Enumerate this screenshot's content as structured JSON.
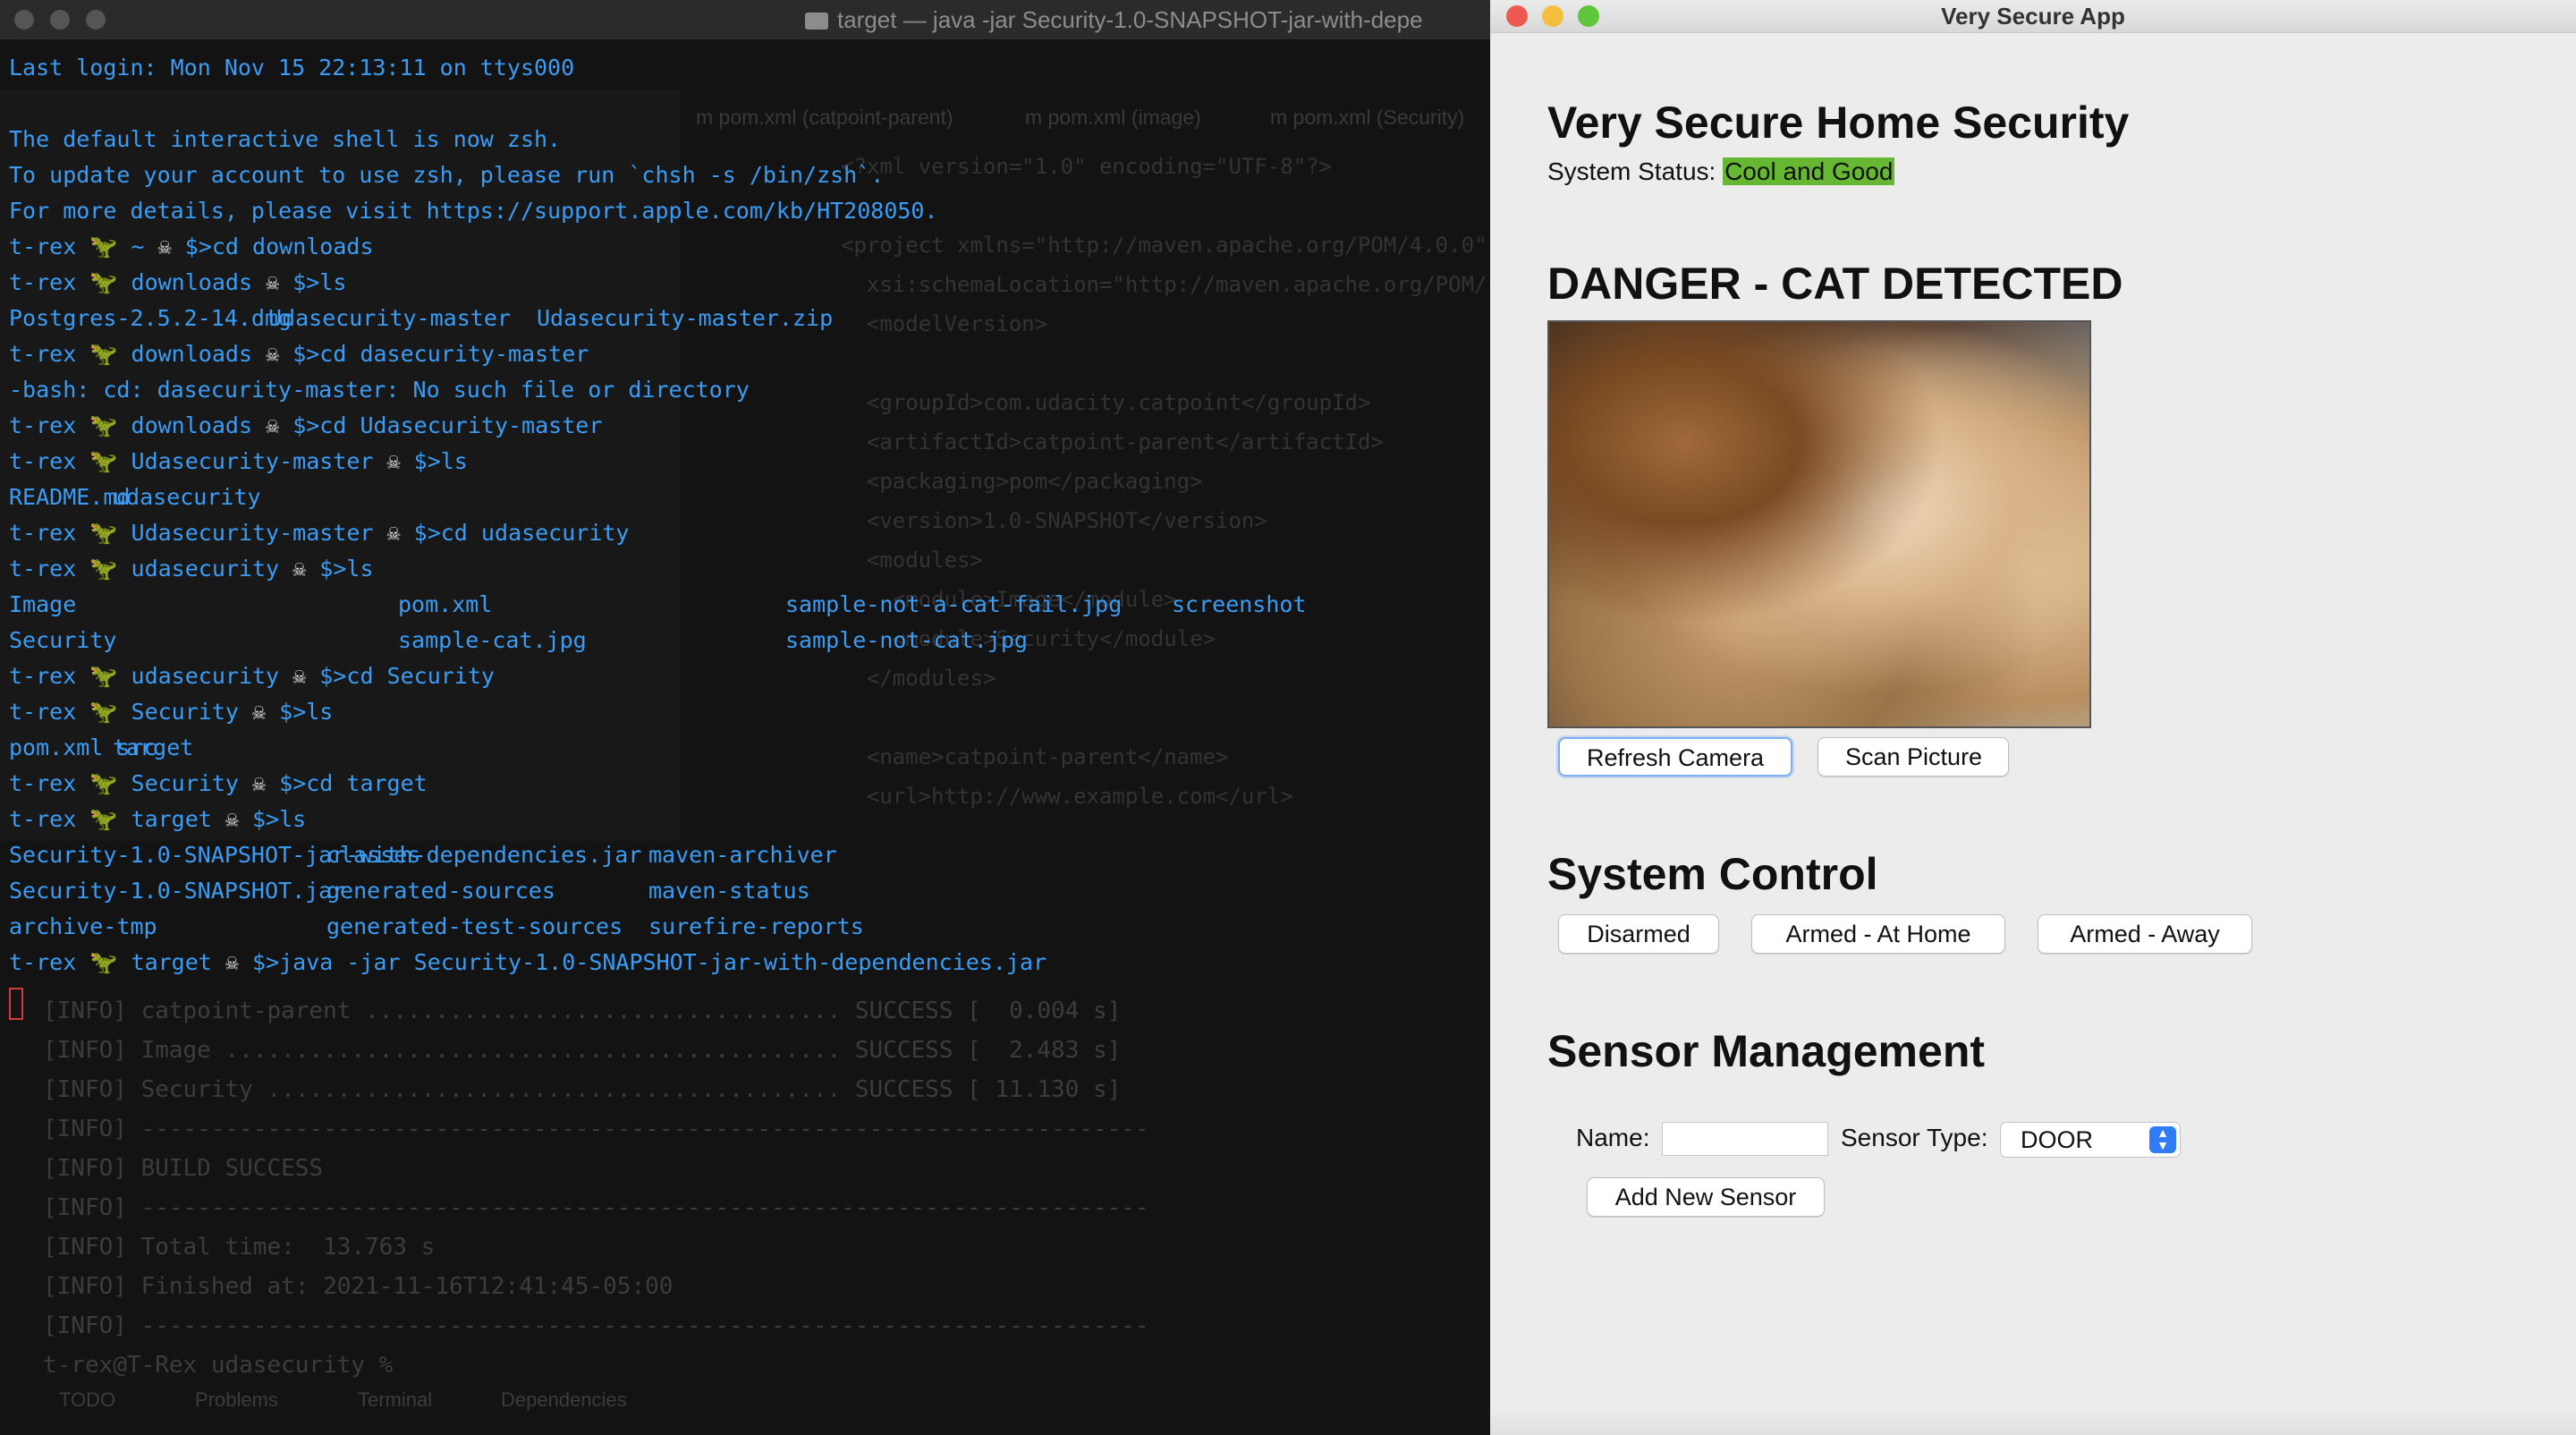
{
  "terminal": {
    "title": "target — java -jar Security-1.0-SNAPSHOT-jar-with-depe",
    "lines": [
      {
        "text": "Last login: Mon Nov 15 22:13:11 on ttys000"
      },
      {
        "text": ""
      },
      {
        "text": "The default interactive shell is now zsh."
      },
      {
        "text": "To update your account to use zsh, please run `chsh -s /bin/zsh`."
      },
      {
        "text": "For more details, please visit https://support.apple.com/kb/HT208050."
      },
      {
        "prompt": "t-rex",
        "dir": "~",
        "cmd": "$>cd downloads"
      },
      {
        "prompt": "t-rex",
        "dir": "downloads",
        "cmd": "$>ls"
      },
      {
        "cols": [
          "Postgres-2.5.2-14.dmg",
          "Udasecurity-master",
          "Udasecurity-master.zip"
        ]
      },
      {
        "prompt": "t-rex",
        "dir": "downloads",
        "cmd": "$>cd dasecurity-master"
      },
      {
        "text": "-bash: cd: dasecurity-master: No such file or directory"
      },
      {
        "prompt": "t-rex",
        "dir": "downloads",
        "cmd": "$>cd Udasecurity-master"
      },
      {
        "prompt": "t-rex",
        "dir": "Udasecurity-master",
        "cmd": "$>ls"
      },
      {
        "cols": [
          "README.md",
          "udasecurity"
        ]
      },
      {
        "prompt": "t-rex",
        "dir": "Udasecurity-master",
        "cmd": "$>cd udasecurity"
      },
      {
        "prompt": "t-rex",
        "dir": "udasecurity",
        "cmd": "$>ls"
      },
      {
        "cols": [
          "Image",
          "pom.xml",
          "sample-not-a-cat-fail.jpg",
          "screenshot"
        ]
      },
      {
        "cols": [
          "Security",
          "sample-cat.jpg",
          "sample-not-cat.jpg"
        ]
      },
      {
        "prompt": "t-rex",
        "dir": "udasecurity",
        "cmd": "$>cd Security"
      },
      {
        "prompt": "t-rex",
        "dir": "Security",
        "cmd": "$>ls"
      },
      {
        "cols": [
          "pom.xml src",
          "target"
        ]
      },
      {
        "prompt": "t-rex",
        "dir": "Security",
        "cmd": "$>cd target"
      },
      {
        "prompt": "t-rex",
        "dir": "target",
        "cmd": "$>ls"
      },
      {
        "cols": [
          "Security-1.0-SNAPSHOT-jar-with-dependencies.jar",
          "classes",
          "maven-archiver"
        ]
      },
      {
        "cols": [
          "Security-1.0-SNAPSHOT.jar",
          "generated-sources",
          "maven-status"
        ]
      },
      {
        "cols": [
          "archive-tmp",
          "generated-test-sources",
          "surefire-reports"
        ]
      },
      {
        "prompt": "t-rex",
        "dir": "target",
        "cmd": "$>java -jar Security-1.0-SNAPSHOT-jar-with-dependencies.jar"
      },
      {
        "cursor": true
      }
    ]
  },
  "app": {
    "window_title": "Very Secure App",
    "title": "Very Secure Home Security",
    "status_label": "System Status:",
    "status_value": "Cool and Good",
    "danger_heading": "DANGER - CAT DETECTED",
    "camera_buttons": {
      "refresh": "Refresh Camera",
      "scan": "Scan Picture"
    },
    "control_heading": "System Control",
    "control_buttons": {
      "disarmed": "Disarmed",
      "armed_home": "Armed - At Home",
      "armed_away": "Armed - Away"
    },
    "sensor_heading": "Sensor Management",
    "name_label": "Name:",
    "name_value": "",
    "type_label": "Sensor Type:",
    "type_value": "DOOR",
    "add_sensor": "Add New Sensor"
  },
  "colors": {
    "status_highlight": "#66b833",
    "terminal_text": "#3a9cf5",
    "select_accent": "#2f7cf6"
  }
}
